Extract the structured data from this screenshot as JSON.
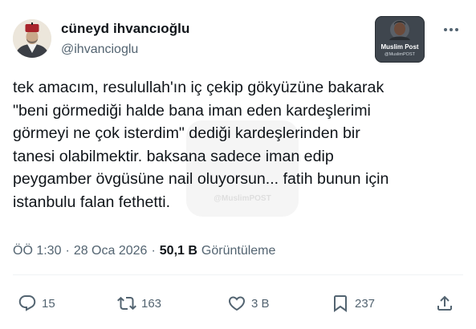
{
  "author": {
    "display_name": "cüneyd ihvancıoğlu",
    "handle": "@ihvancioglu"
  },
  "attached_badge": {
    "title": "Muslim Post",
    "subtitle": "@MuslimPOST"
  },
  "watermark": {
    "text": "@MuslimPOST"
  },
  "tweet": {
    "text": "tek amacım, resulullah'ın iç çekip gökyüzüne bakarak\n\"beni görmediği halde bana iman eden kardeşlerimi\ngörmeyi ne çok isterdim\" dediği kardeşlerinden bir\ntanesi olabilmektir. baksana sadece iman edip\npeygamber övgüsüne nail oluyorsun... fatih bunun için\nistanbulu falan fethetti."
  },
  "meta": {
    "time": "ÖÖ 1:30",
    "separator": "·",
    "date": "28 Oca 2026",
    "views_count": "50,1 B",
    "views_label": "Görüntüleme"
  },
  "actions": {
    "replies": "15",
    "retweets": "163",
    "likes": "3 B",
    "bookmarks": "237"
  },
  "icons": {
    "more": "more-dots-icon",
    "reply": "reply-icon",
    "retweet": "retweet-icon",
    "like": "heart-icon",
    "bookmark": "bookmark-icon",
    "share": "share-icon"
  },
  "colors": {
    "text": "#0f1419",
    "secondary": "#536471",
    "divider": "#eff3f4"
  }
}
